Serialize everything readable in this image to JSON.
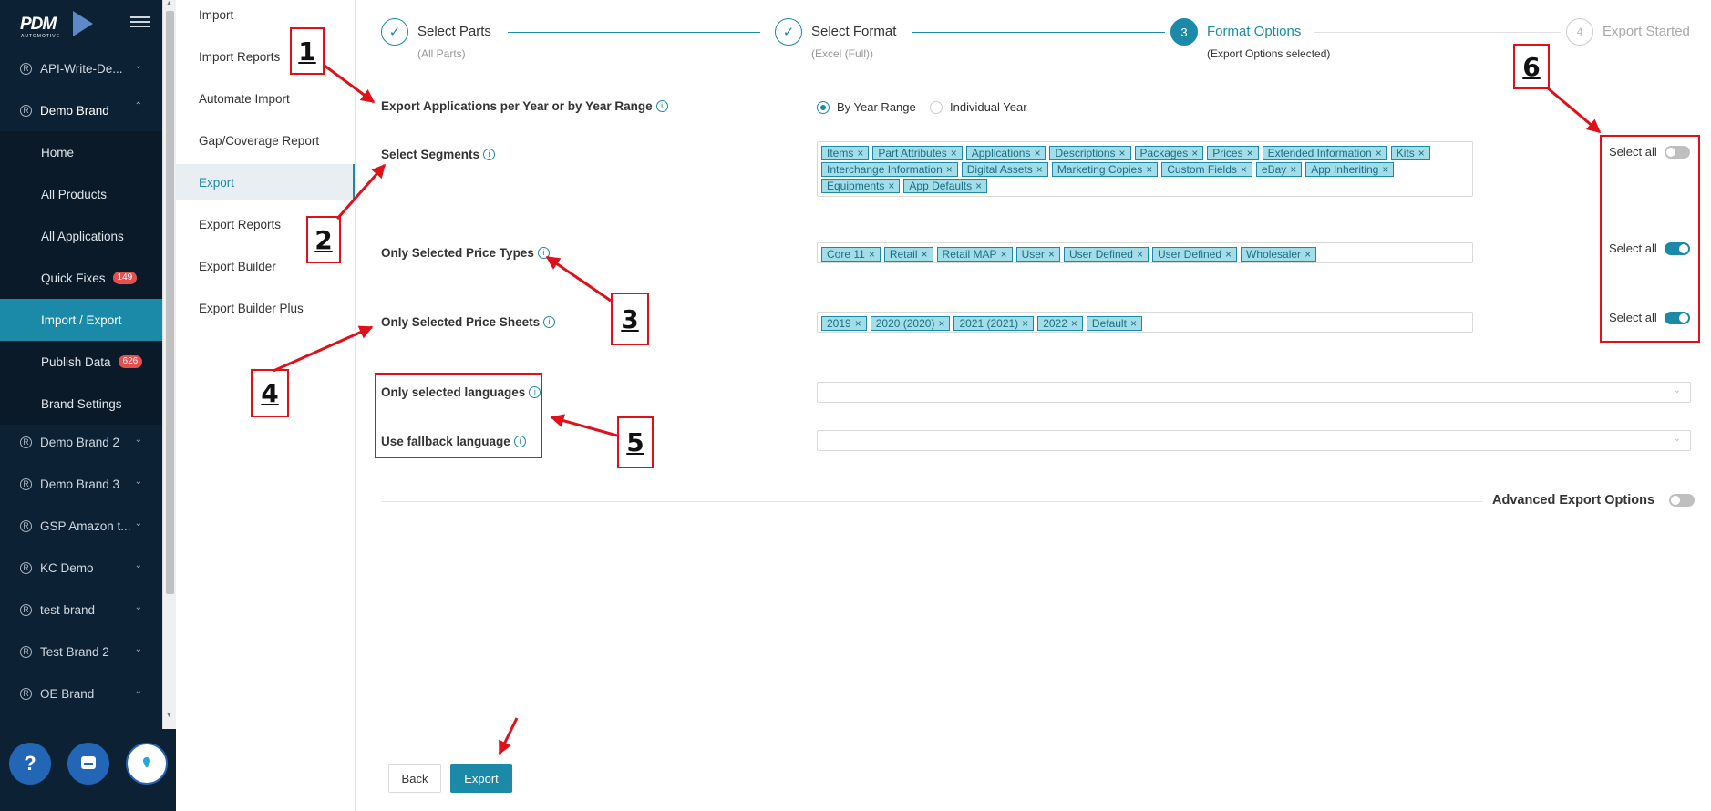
{
  "sidebar": {
    "logo": "PDM",
    "logo_sub": "AUTOMOTIVE",
    "items": [
      {
        "label": "API-Write-De..."
      },
      {
        "label": "Demo Brand"
      },
      {
        "label": "Demo Brand 2"
      },
      {
        "label": "Demo Brand 3"
      },
      {
        "label": "GSP Amazon t..."
      },
      {
        "label": "KC Demo"
      },
      {
        "label": "test brand"
      },
      {
        "label": "Test Brand 2"
      },
      {
        "label": "OE Brand"
      }
    ],
    "subitems": [
      {
        "label": "Home"
      },
      {
        "label": "All Products"
      },
      {
        "label": "All Applications"
      },
      {
        "label": "Quick Fixes",
        "badge": "149"
      },
      {
        "label": "Import / Export"
      },
      {
        "label": "Publish Data",
        "badge": "626"
      },
      {
        "label": "Brand Settings"
      }
    ],
    "help": "?"
  },
  "submenu": [
    "Import",
    "Import Reports",
    "Automate Import",
    "Gap/Coverage Report",
    "Export",
    "Export Reports",
    "Export Builder",
    "Export Builder Plus"
  ],
  "steps": [
    {
      "icon": "✓",
      "title": "Select Parts",
      "sub": "(All Parts)"
    },
    {
      "icon": "✓",
      "title": "Select Format",
      "sub": "(Excel (Full))"
    },
    {
      "icon": "3",
      "title": "Format Options",
      "sub": "(Export Options selected)"
    },
    {
      "icon": "4",
      "title": "Export Started",
      "sub": ""
    }
  ],
  "form": {
    "apps_label": "Export Applications per Year or by Year Range",
    "radio_range": "By Year Range",
    "radio_individual": "Individual Year",
    "segments_label": "Select Segments",
    "segments": [
      "Items",
      "Part Attributes",
      "Applications",
      "Descriptions",
      "Packages",
      "Prices",
      "Extended Information",
      "Kits",
      "Interchange Information",
      "Digital Assets",
      "Marketing Copies",
      "Custom Fields",
      "eBay",
      "App Inheriting",
      "Equipments",
      "App Defaults"
    ],
    "price_types_label": "Only Selected Price Types",
    "price_types": [
      "Core 11",
      "Retail",
      "Retail MAP",
      "User",
      "User Defined",
      "User Defined",
      "Wholesaler"
    ],
    "price_sheets_label": "Only Selected Price Sheets",
    "price_sheets": [
      "2019",
      "2020 (2020)",
      "2021 (2021)",
      "2022",
      "Default"
    ],
    "languages_label": "Only selected languages",
    "fallback_label": "Use fallback language",
    "select_all": "Select all",
    "advanced": "Advanced Export Options"
  },
  "buttons": {
    "back": "Back",
    "export": "Export"
  },
  "annotations": [
    "1",
    "2",
    "3",
    "4",
    "5",
    "6"
  ],
  "colors": {
    "accent": "#1b8aa8",
    "sidebar": "#0d2134",
    "annotation": "#e0101a",
    "tag_bg": "#a3dde8"
  }
}
